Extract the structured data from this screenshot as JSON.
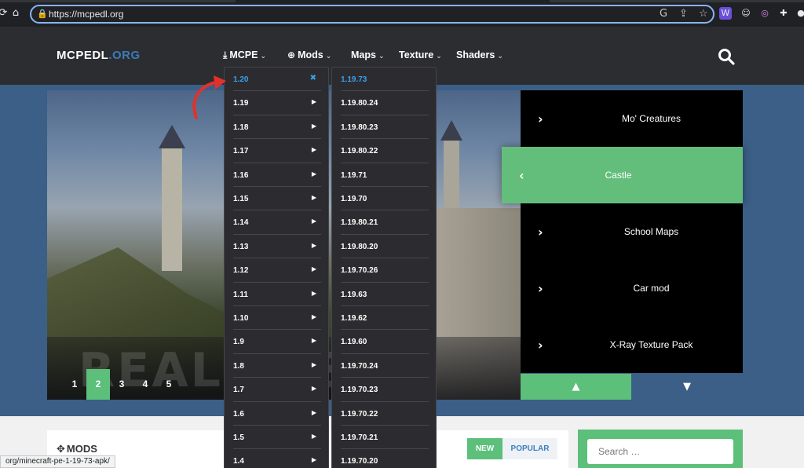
{
  "browser": {
    "url": "https://mcpedl.org",
    "status_url": "org/minecraft-pe-1-19-73-apk/"
  },
  "header": {
    "logo_main": "MCPEDL",
    "logo_accent": ".ORG",
    "nav": [
      {
        "label": "MCPE",
        "icon": "download-icon"
      },
      {
        "label": "Mods",
        "icon": "lifebuoy-icon"
      },
      {
        "label": "Maps",
        "icon": ""
      },
      {
        "label": "Texture",
        "icon": ""
      },
      {
        "label": "Shaders",
        "icon": ""
      }
    ]
  },
  "menu_versions": [
    {
      "label": "1.20",
      "selected": true
    },
    {
      "label": "1.19"
    },
    {
      "label": "1.18"
    },
    {
      "label": "1.17"
    },
    {
      "label": "1.16"
    },
    {
      "label": "1.15"
    },
    {
      "label": "1.14"
    },
    {
      "label": "1.13"
    },
    {
      "label": "1.12"
    },
    {
      "label": "1.11"
    },
    {
      "label": "1.10"
    },
    {
      "label": "1.9"
    },
    {
      "label": "1.8"
    },
    {
      "label": "1.7"
    },
    {
      "label": "1.6"
    },
    {
      "label": "1.5"
    },
    {
      "label": "1.4"
    }
  ],
  "menu_subversions": [
    "1.19.73",
    "1.19.80.24",
    "1.19.80.23",
    "1.19.80.22",
    "1.19.71",
    "1.19.70",
    "1.19.80.21",
    "1.19.80.20",
    "1.19.70.26",
    "1.19.63",
    "1.19.62",
    "1.19.60",
    "1.19.70.24",
    "1.19.70.23",
    "1.19.70.22",
    "1.19.70.21",
    "1.19.70.20"
  ],
  "slider": {
    "overlay_text": "REAL I       TS",
    "pages": [
      "1",
      "2",
      "3",
      "4",
      "5"
    ],
    "active_page": 1,
    "items": [
      "Mo' Creatures",
      "Castle",
      "School Maps",
      "Car mod",
      "X-Ray Texture Pack"
    ],
    "active_item": 1
  },
  "content": {
    "section_title": "MODS",
    "tab_new": "NEW",
    "tab_popular": "POPULAR",
    "search_placeholder": "Search …"
  },
  "colors": {
    "accent_green": "#5cbf7a",
    "link_blue": "#3aa0e8",
    "header_bg": "#2b2d31",
    "band_blue": "#3b5f86"
  }
}
